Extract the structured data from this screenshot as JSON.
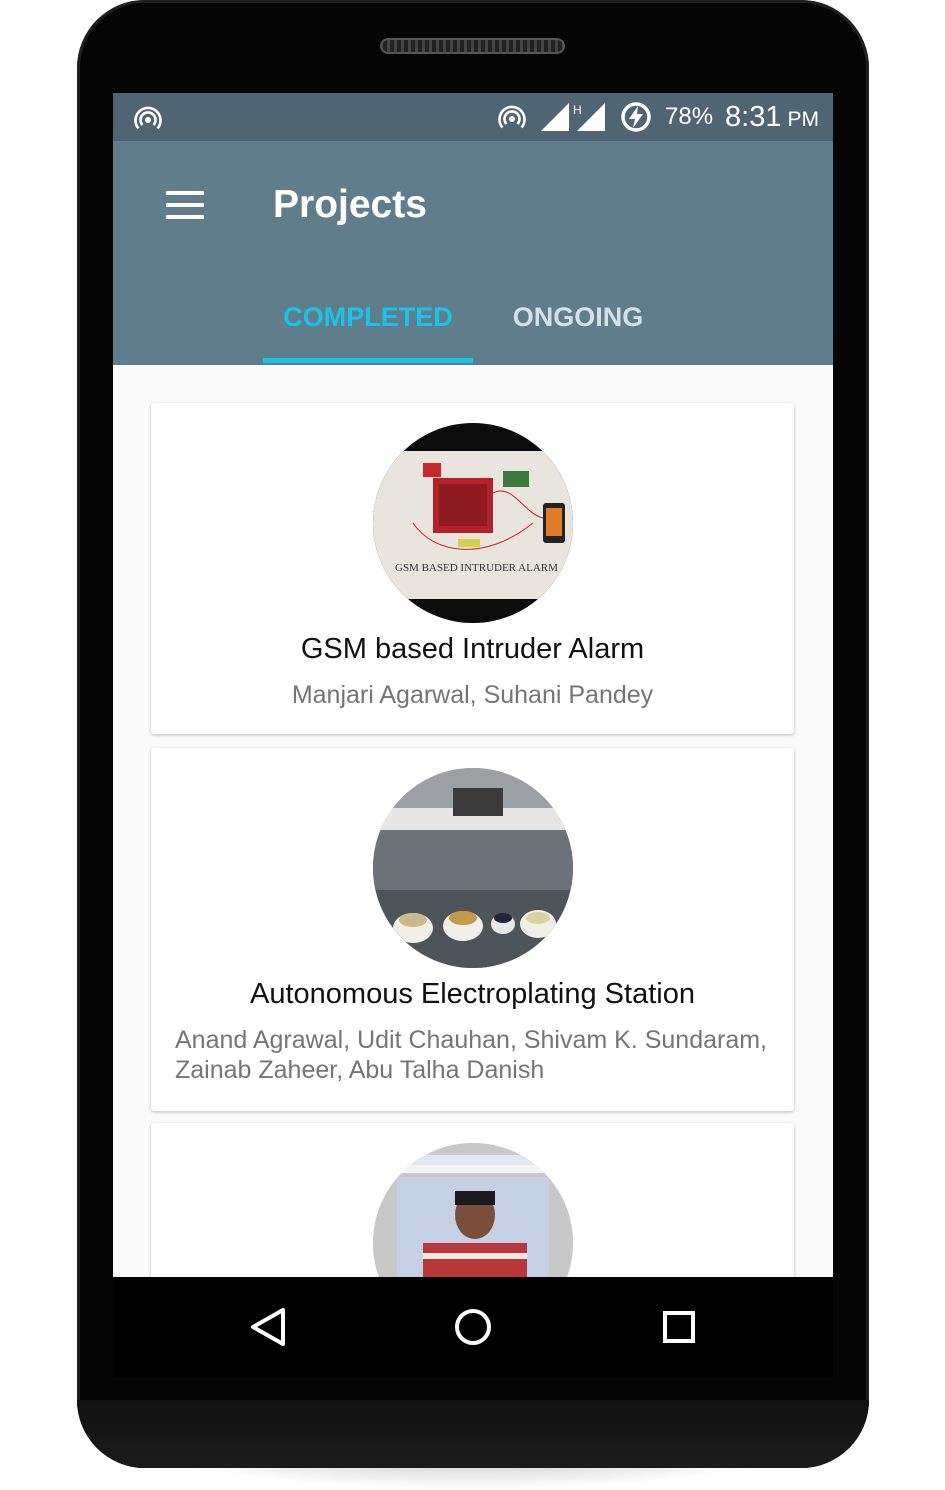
{
  "statusbar": {
    "battery_percent": "78%",
    "time": "8:31",
    "ampm": "PM",
    "network_type": "H",
    "icons": [
      "hotspot-icon",
      "hotspot-icon",
      "signal-icon",
      "data-saver-icon"
    ]
  },
  "appbar": {
    "title": "Projects",
    "menu_icon": "menu-icon"
  },
  "tabs": [
    {
      "label": "COMPLETED",
      "selected": true
    },
    {
      "label": "ONGOING",
      "selected": false
    }
  ],
  "projects": [
    {
      "title": "GSM based Intruder Alarm",
      "authors": "Manjari Agarwal, Suhani Pandey",
      "image_label": "GSM BASED INTRUDER ALARM"
    },
    {
      "title": "Autonomous Electroplating Station",
      "authors": "Anand Agrawal, Udit Chauhan, Shivam K. Sundaram, Zainab Zaheer, Abu Talha Danish"
    },
    {
      "title": "",
      "authors": ""
    }
  ],
  "navbar": {
    "back_icon": "back-icon",
    "home_icon": "home-icon",
    "recents_icon": "recents-icon"
  },
  "colors": {
    "appbar": "#607d8b",
    "statusbar": "#4f6572",
    "accent": "#1cc3e8"
  }
}
